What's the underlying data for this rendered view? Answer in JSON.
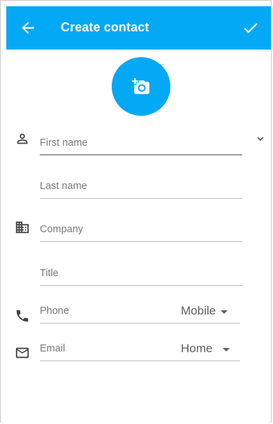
{
  "header": {
    "title": "Create contact",
    "back_icon": "arrow-left-icon",
    "save_icon": "check-icon"
  },
  "photo": {
    "icon": "add-photo-icon"
  },
  "form": {
    "first_name_placeholder": "First name",
    "last_name_placeholder": "Last name",
    "company_placeholder": "Company",
    "title_placeholder": "Title",
    "phone_placeholder": "Phone",
    "phone_type": "Mobile",
    "email_placeholder": "Email",
    "email_type": "Home"
  },
  "colors": {
    "accent": "#03a9f4",
    "icon": "#424242",
    "hint": "#7a7a7a"
  }
}
